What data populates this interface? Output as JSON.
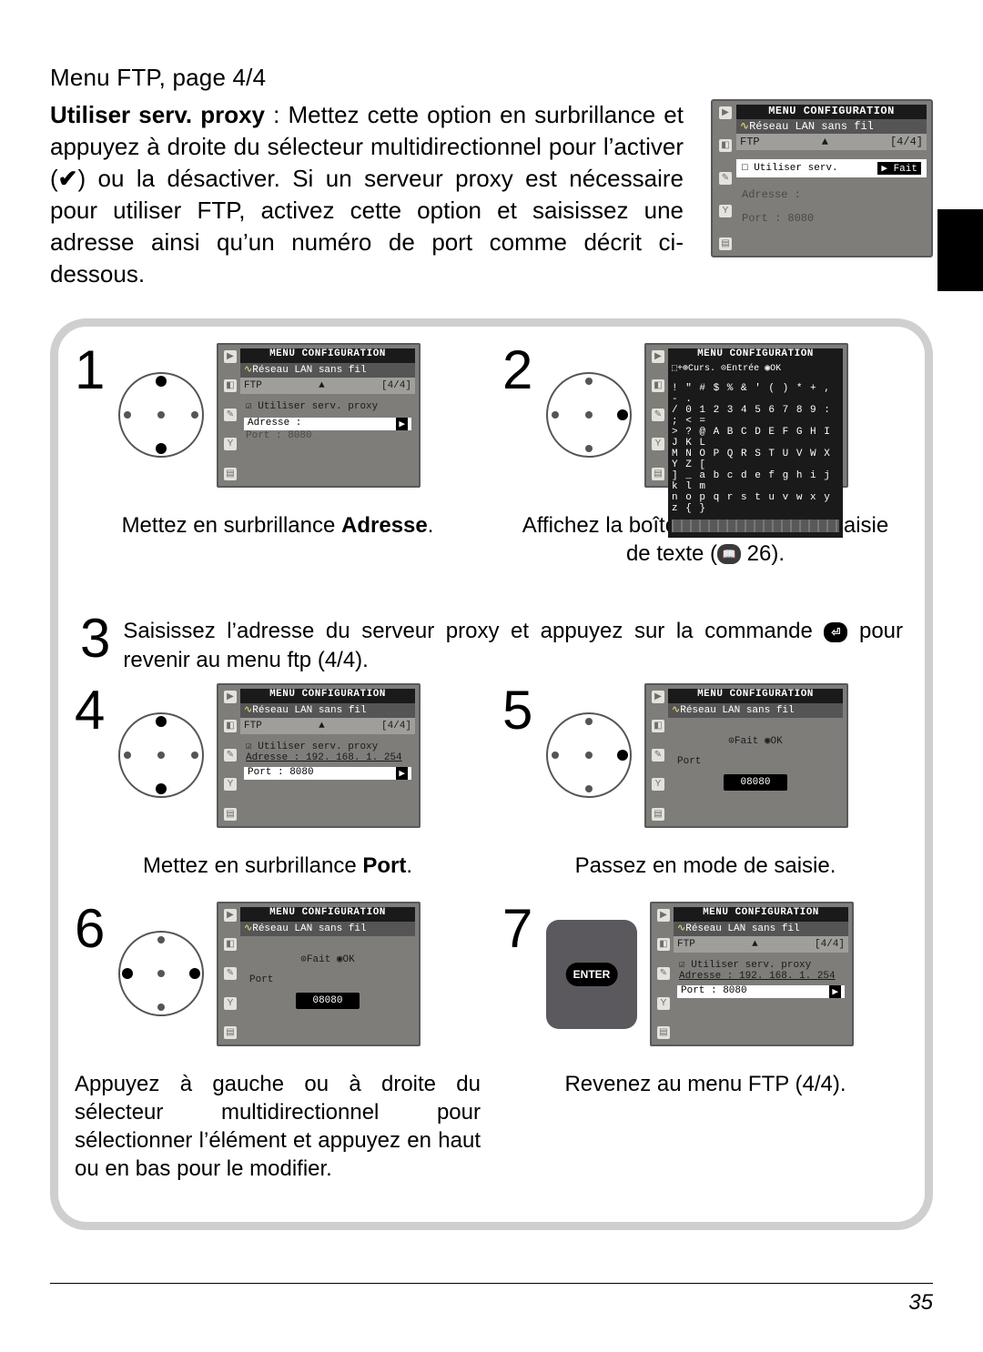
{
  "page_number": "35",
  "title": "Menu FTP, page 4/4",
  "intro": {
    "lead_bold": "Utiliser serv. proxy",
    "text_before_check": " : Mettez cette option en surbrillance et appuyez à droite du sélecteur multidirectionnel pour l’activer (",
    "check": "✔",
    "text_after_check": ") ou la désactiver. Si un serveur proxy est nécessaire pour utiliser FTP, activez cette option et saisissez une adresse ainsi qu’un numéro de port comme décrit ci-dessous."
  },
  "top_lcd": {
    "menu": "MENU CONFIGURATION",
    "sub": "Réseau LAN sans fil",
    "bar_left": "FTP",
    "bar_right": "[4/4]",
    "pill_left": "□  Utiliser serv.",
    "pill_right": "▶ Fait",
    "line1": "Adresse :",
    "line2": "Port   : 8080"
  },
  "steps": {
    "1": {
      "num": "1",
      "caption_pre": "Mettez en surbrillance ",
      "caption_bold": "Adresse",
      "caption_post": ".",
      "lcd": {
        "menu": "MENU CONFIGURATION",
        "sub": "Réseau LAN sans fil",
        "bar_left": "FTP",
        "bar_right": "[4/4]",
        "row": "☑  Utiliser serv. proxy",
        "hl": "Adresse :",
        "hl_arrow": "▶",
        "faint": "Port   : 8080"
      }
    },
    "2": {
      "num": "2",
      "caption_line1": "Affichez la boîte de dialogue de saisie",
      "caption_line2_pre": "de texte (",
      "caption_line2_post": " 26).",
      "lcd": {
        "menu": "MENU CONFIGURATION",
        "hint": "⬚+⊕Curs. ⊙Entrée ◉OK",
        "rows": [
          "! \" # $ % & ' ( ) * + , - .",
          "/ 0 1 2 3 4 5 6 7 8 9 : ; < =",
          "> ? @ A B C D E F G H I J K L",
          "M N O P Q R S T U V W X Y Z [",
          "] _ a b c d e f g h i j k l m",
          "n o p q r s t u v w x y z { }"
        ]
      }
    },
    "3": {
      "num": "3",
      "text_before_icon": "Saisissez l’adresse du serveur proxy et appuyez sur la commande ",
      "text_after_icon": " pour revenir au menu ftp (4/4)."
    },
    "4": {
      "num": "4",
      "caption_pre": "Mettez en surbrillance ",
      "caption_bold": "Port",
      "caption_post": ".",
      "lcd": {
        "menu": "MENU CONFIGURATION",
        "sub": "Réseau LAN sans fil",
        "bar_left": "FTP",
        "bar_right": "[4/4]",
        "row": "☑  Utiliser serv. proxy",
        "ad": "Adresse : 192. 168. 1. 254",
        "hl": "Port   : 8080",
        "hl_arrow": "▶"
      }
    },
    "5": {
      "num": "5",
      "caption": "Passez en mode de saisie.",
      "lcd": {
        "menu": "MENU CONFIGURATION",
        "sub": "Réseau LAN sans fil",
        "hint": "⊙Fait    ◉OK",
        "label": "Port",
        "port": "08080"
      }
    },
    "6": {
      "num": "6",
      "caption": "Appuyez à gauche ou à droite du sélecteur multidirectionnel pour sélectionner l’élément et appuyez en haut ou en bas pour le modifier.",
      "lcd": {
        "menu": "MENU CONFIGURATION",
        "sub": "Réseau LAN sans fil",
        "hint": "⊙Fait    ◉OK",
        "label": "Port",
        "port": "08080"
      }
    },
    "7": {
      "num": "7",
      "caption": "Revenez au menu FTP (4/4).",
      "lcd": {
        "menu": "MENU CONFIGURATION",
        "sub": "Réseau LAN sans fil",
        "bar_left": "FTP",
        "bar_right": "[4/4]",
        "row": "☑  Utiliser serv. proxy",
        "ad": "Adresse : 192. 168. 1. 254",
        "hl": "Port   : 8080",
        "hl_arrow": "▶"
      }
    }
  },
  "icons": {
    "enter": "ENTER",
    "book": "📖"
  }
}
